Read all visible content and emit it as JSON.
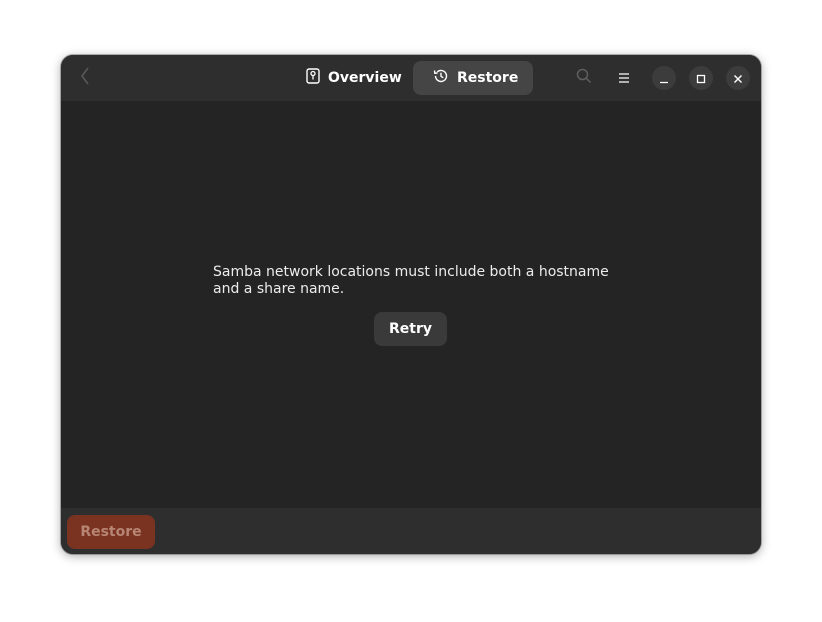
{
  "header": {
    "tabs": [
      {
        "label": "Overview",
        "icon": "overview-icon",
        "active": false
      },
      {
        "label": "Restore",
        "icon": "history-icon",
        "active": true
      }
    ],
    "icons": [
      "back-icon",
      "search-icon",
      "menu-icon",
      "minimize-icon",
      "maximize-icon",
      "close-icon"
    ]
  },
  "main": {
    "error_message": "Samba network locations must include both a hostname and a share name.",
    "retry_label": "Retry"
  },
  "footer": {
    "restore_label": "Restore",
    "restore_color": "#7a3320"
  },
  "colors": {
    "window_bg": "#242424",
    "headerbar_bg": "#2e2e2e",
    "active_tab_bg": "#454545"
  }
}
